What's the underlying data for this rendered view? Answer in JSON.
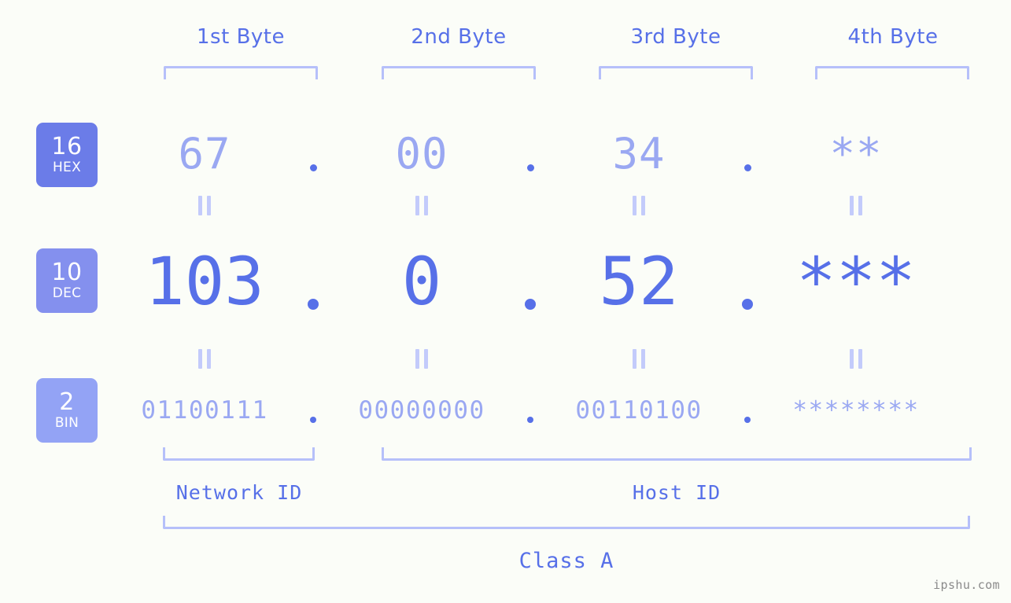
{
  "background_color": "#fbfdf8",
  "accent_color": "#5770e8",
  "muted_accent_color": "#9aa8f2",
  "bracket_color": "#b6c0fa",
  "byte_headers": [
    {
      "label": "1st Byte"
    },
    {
      "label": "2nd Byte"
    },
    {
      "label": "3rd Byte"
    },
    {
      "label": "4th Byte"
    }
  ],
  "bases": [
    {
      "id": "hex",
      "number": "16",
      "system": "HEX",
      "color": "#6b7ce8"
    },
    {
      "id": "dec",
      "number": "10",
      "system": "DEC",
      "color": "#8490ee"
    },
    {
      "id": "bin",
      "number": "2",
      "system": "BIN",
      "color": "#93a3f5"
    }
  ],
  "rows": {
    "hex": {
      "values": [
        "67",
        "00",
        "34",
        "**"
      ]
    },
    "dec": {
      "values": [
        "103",
        "0",
        "52",
        "***"
      ]
    },
    "bin": {
      "values": [
        "01100111",
        "00000000",
        "00110100",
        "********"
      ]
    }
  },
  "separator": ".",
  "equality_symbol": "=",
  "sections": {
    "network_id": "Network ID",
    "host_id": "Host ID",
    "class": "Class A"
  },
  "watermark": "ipshu.com"
}
